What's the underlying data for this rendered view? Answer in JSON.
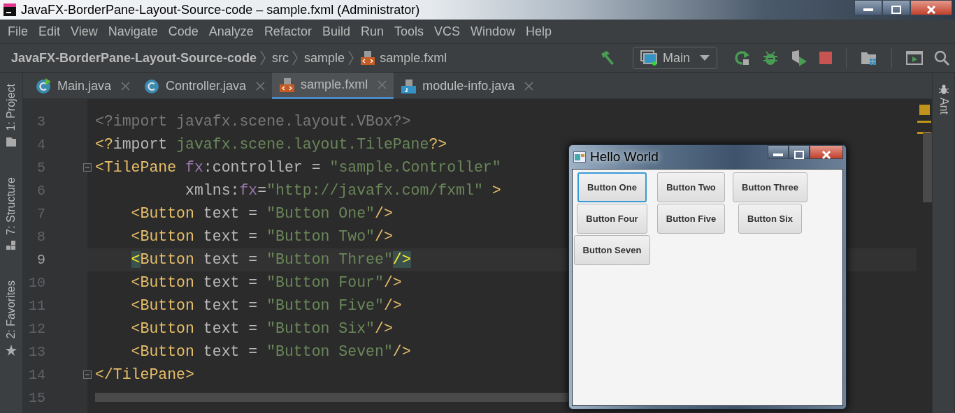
{
  "window": {
    "title": "JavaFX-BorderPane-Layout-Source-code – sample.fxml (Administrator)"
  },
  "menu": [
    "File",
    "Edit",
    "View",
    "Navigate",
    "Code",
    "Analyze",
    "Refactor",
    "Build",
    "Run",
    "Tools",
    "VCS",
    "Window",
    "Help"
  ],
  "breadcrumb": [
    {
      "label": "JavaFX-BorderPane-Layout-Source-code",
      "kind": "project"
    },
    {
      "label": "src",
      "kind": "folder"
    },
    {
      "label": "sample",
      "kind": "folder"
    },
    {
      "label": "sample.fxml",
      "kind": "fxml"
    }
  ],
  "run_config": {
    "label": "Main"
  },
  "tool_windows_left": [
    {
      "label": "1: Project",
      "kind": "project"
    },
    {
      "label": "7: Structure",
      "kind": "structure"
    },
    {
      "label": "2: Favorites",
      "kind": "favorites"
    }
  ],
  "tool_windows_right": [
    {
      "label": "Ant",
      "kind": "ant"
    }
  ],
  "tabs": [
    {
      "label": "Main.java",
      "kind": "main",
      "selected": false
    },
    {
      "label": "Controller.java",
      "kind": "class",
      "selected": false
    },
    {
      "label": "sample.fxml",
      "kind": "fxml",
      "selected": true
    },
    {
      "label": "module-info.java",
      "kind": "module",
      "selected": false
    }
  ],
  "editor": {
    "lines": [
      {
        "number": "3",
        "current": false,
        "fold": false,
        "tokens": [
          {
            "kind": "unused",
            "text": "<?import javafx.scene.layout.VBox?>"
          }
        ]
      },
      {
        "number": "4",
        "current": false,
        "fold": false,
        "tokens": [
          {
            "kind": "tag",
            "text": "<?"
          },
          {
            "kind": "plain",
            "text": "import "
          },
          {
            "kind": "string",
            "text": "javafx.scene.layout.TilePane"
          },
          {
            "kind": "tag",
            "text": "?>"
          }
        ]
      },
      {
        "number": "5",
        "current": false,
        "fold": true,
        "tokens": [
          {
            "kind": "tag",
            "text": "<TilePane "
          },
          {
            "kind": "ns",
            "text": "fx"
          },
          {
            "kind": "plain",
            "text": ":controller = "
          },
          {
            "kind": "string",
            "text": "\"sample.Controller\""
          }
        ]
      },
      {
        "number": "6",
        "current": false,
        "fold": false,
        "tokens": [
          {
            "kind": "plain",
            "text": "          xmlns:"
          },
          {
            "kind": "ns",
            "text": "fx"
          },
          {
            "kind": "plain",
            "text": "="
          },
          {
            "kind": "string",
            "text": "\"http://javafx.com/fxml\""
          },
          {
            "kind": "tag",
            "text": " >"
          }
        ]
      },
      {
        "number": "7",
        "current": false,
        "fold": false,
        "tokens": [
          {
            "kind": "tag",
            "text": "    <Button"
          },
          {
            "kind": "plain",
            "text": " text = "
          },
          {
            "kind": "string",
            "text": "\"Button One\""
          },
          {
            "kind": "tag",
            "text": "/>"
          }
        ]
      },
      {
        "number": "8",
        "current": false,
        "fold": false,
        "tokens": [
          {
            "kind": "tag",
            "text": "    <Button"
          },
          {
            "kind": "plain",
            "text": " text = "
          },
          {
            "kind": "string",
            "text": "\"Button Two\""
          },
          {
            "kind": "tag",
            "text": "/>"
          }
        ]
      },
      {
        "number": "9",
        "current": true,
        "fold": false,
        "tokens": [
          {
            "kind": "tag",
            "text": "    <",
            "matched": true
          },
          {
            "kind": "tag",
            "text": "Button"
          },
          {
            "kind": "plain",
            "text": " text = "
          },
          {
            "kind": "string",
            "text": "\"Button Three\""
          },
          {
            "kind": "tag",
            "text": "/>",
            "matched": true
          }
        ]
      },
      {
        "number": "10",
        "current": false,
        "fold": false,
        "tokens": [
          {
            "kind": "tag",
            "text": "    <Button"
          },
          {
            "kind": "plain",
            "text": " text = "
          },
          {
            "kind": "string",
            "text": "\"Button Four\""
          },
          {
            "kind": "tag",
            "text": "/>"
          }
        ]
      },
      {
        "number": "11",
        "current": false,
        "fold": false,
        "tokens": [
          {
            "kind": "tag",
            "text": "    <Button"
          },
          {
            "kind": "plain",
            "text": " text = "
          },
          {
            "kind": "string",
            "text": "\"Button Five\""
          },
          {
            "kind": "tag",
            "text": "/>"
          }
        ]
      },
      {
        "number": "12",
        "current": false,
        "fold": false,
        "tokens": [
          {
            "kind": "tag",
            "text": "    <Button"
          },
          {
            "kind": "plain",
            "text": " text = "
          },
          {
            "kind": "string",
            "text": "\"Button Six\""
          },
          {
            "kind": "tag",
            "text": "/>"
          }
        ]
      },
      {
        "number": "13",
        "current": false,
        "fold": false,
        "tokens": [
          {
            "kind": "tag",
            "text": "    <Button"
          },
          {
            "kind": "plain",
            "text": " text = "
          },
          {
            "kind": "string",
            "text": "\"Button Seven\""
          },
          {
            "kind": "tag",
            "text": "/>"
          }
        ]
      },
      {
        "number": "14",
        "current": false,
        "fold": true,
        "tokens": [
          {
            "kind": "tag",
            "text": "</TilePane>"
          }
        ]
      },
      {
        "number": "15",
        "current": false,
        "fold": false
      }
    ]
  },
  "app_window": {
    "title": "Hello World",
    "buttons": [
      {
        "label": "Button One",
        "focused": true
      },
      {
        "label": "Button Two",
        "focused": false
      },
      {
        "label": "Button Three",
        "focused": false
      },
      {
        "label": "Button Four",
        "focused": false
      },
      {
        "label": "Button Five",
        "focused": false
      },
      {
        "label": "Button Six",
        "focused": false
      },
      {
        "label": "Button Seven",
        "focused": false
      }
    ]
  }
}
